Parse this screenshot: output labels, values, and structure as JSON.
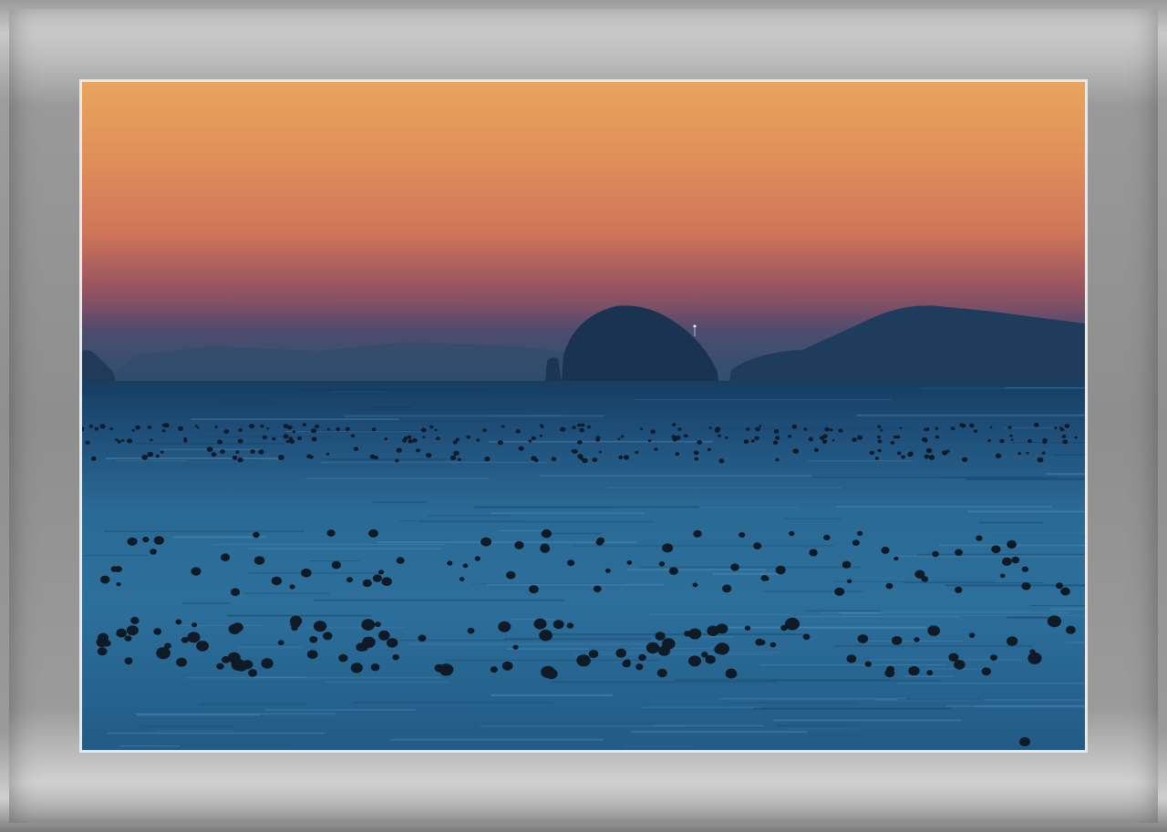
{
  "image": {
    "subject": "sunset-seascape",
    "colors": {
      "sky_top": "#e8a25a",
      "sky_mid": "#d67a58",
      "sky_low": "#8a4f62",
      "haze": "#3e4d72",
      "island": "#1c3550",
      "sea_far": "#1f4f78",
      "sea_near": "#2c6f99",
      "buoy": "#0e1a26",
      "frame": "#9a9a9a"
    }
  }
}
